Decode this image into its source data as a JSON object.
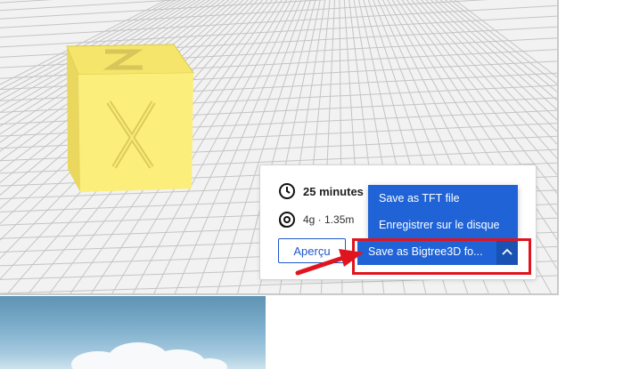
{
  "print_panel": {
    "time_text": "25 minutes",
    "material_text": "4g · 1.35m",
    "preview_label": "Aperçu",
    "save_button_label": "Save as Bigtree3D fo...",
    "menu": [
      "Save as TFT file",
      "Enregistrer sur le disque"
    ]
  },
  "colors": {
    "accent": "#1f63d6",
    "highlight": "#e0141e",
    "cube": "#f7ea72"
  },
  "icons": [
    "clock-icon",
    "spool-icon",
    "chevron-up-icon",
    "arrow-annotation"
  ]
}
